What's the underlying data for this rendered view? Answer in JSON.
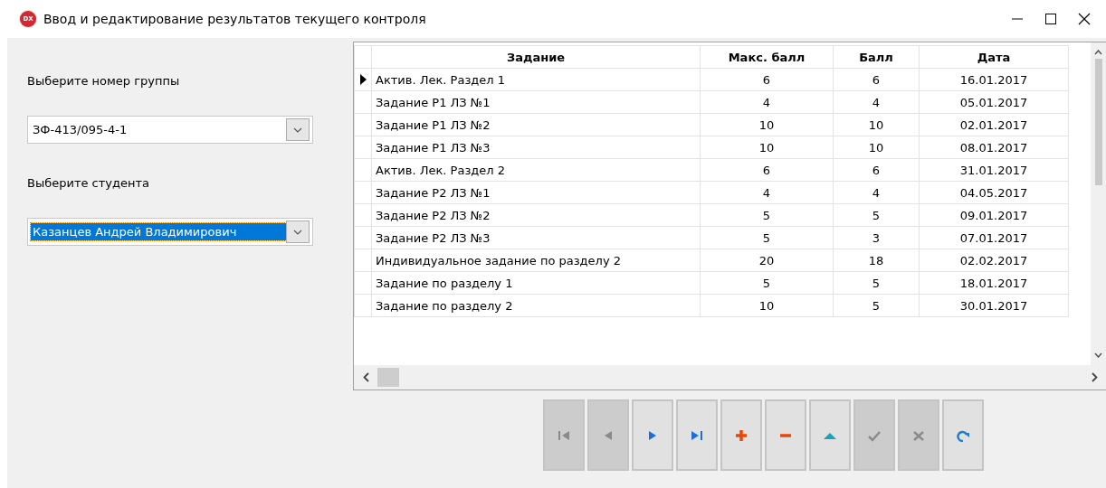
{
  "window": {
    "title": "Ввод и редактирование результатов текущего контроля",
    "app_icon_text": "DX"
  },
  "group": {
    "label": "Выберите номер группы",
    "value": "ЗФ-413/095-4-1",
    "focused": false
  },
  "student": {
    "label": "Выберите студента",
    "value": "Казанцев Андрей Владимирович",
    "focused": true
  },
  "table": {
    "columns": [
      "Задание",
      "Макс. балл",
      "Балл",
      "Дата"
    ],
    "rows": [
      {
        "cells": [
          "Актив. Лек. Раздел 1",
          "6",
          "6",
          "16.01.2017"
        ],
        "selected": true
      },
      {
        "cells": [
          "Задание Р1 ЛЗ №1",
          "4",
          "4",
          "05.01.2017"
        ],
        "selected": false
      },
      {
        "cells": [
          "Задание Р1 ЛЗ №2",
          "10",
          "10",
          "02.01.2017"
        ],
        "selected": false
      },
      {
        "cells": [
          "Задание Р1 ЛЗ №3",
          "10",
          "10",
          "08.01.2017"
        ],
        "selected": false
      },
      {
        "cells": [
          "Актив. Лек. Раздел 2",
          "6",
          "6",
          "31.01.2017"
        ],
        "selected": false
      },
      {
        "cells": [
          "Задание Р2 ЛЗ №1",
          "4",
          "4",
          "04.05.2017"
        ],
        "selected": false
      },
      {
        "cells": [
          "Задание Р2 ЛЗ №2",
          "5",
          "5",
          "09.01.2017"
        ],
        "selected": false
      },
      {
        "cells": [
          "Задание Р2 ЛЗ №3",
          "5",
          "3",
          "07.01.2017"
        ],
        "selected": false
      },
      {
        "cells": [
          "Индивидуальное задание по разделу 2",
          "20",
          "18",
          "02.02.2017"
        ],
        "selected": false
      },
      {
        "cells": [
          "Задание по разделу 1",
          "5",
          "5",
          "18.01.2017"
        ],
        "selected": false
      },
      {
        "cells": [
          "Задание по разделу 2",
          "10",
          "5",
          "30.01.2017"
        ],
        "selected": false
      }
    ]
  },
  "navigator": [
    {
      "kind": "first",
      "disabled": true
    },
    {
      "kind": "prior",
      "disabled": true
    },
    {
      "kind": "next",
      "disabled": false
    },
    {
      "kind": "last",
      "disabled": false
    },
    {
      "kind": "insert",
      "disabled": false
    },
    {
      "kind": "delete",
      "disabled": false
    },
    {
      "kind": "edit",
      "disabled": false
    },
    {
      "kind": "post",
      "disabled": true
    },
    {
      "kind": "cancel",
      "disabled": true
    },
    {
      "kind": "refresh",
      "disabled": false
    }
  ]
}
